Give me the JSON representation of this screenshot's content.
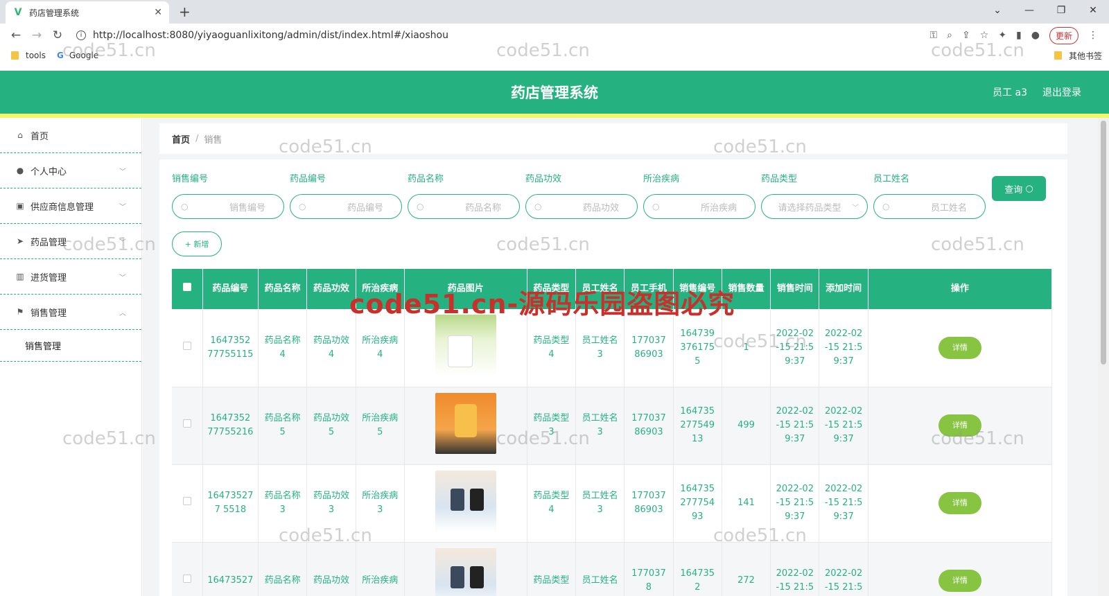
{
  "browser": {
    "tab_title": "药店管理系统",
    "url": "http://localhost:8080/yiyaoguanlixitong/admin/dist/index.html#/xiaoshou",
    "update_label": "更新",
    "bookmarks": [
      "tools",
      "Google"
    ],
    "other_bookmarks": "其他书签"
  },
  "header": {
    "title": "药店管理系统",
    "user_label": "员工 a3",
    "logout_label": "退出登录"
  },
  "sidebar": {
    "items": [
      {
        "label": "首页",
        "icon": "home-icon"
      },
      {
        "label": "个人中心",
        "icon": "user-icon"
      },
      {
        "label": "供应商信息管理",
        "icon": "clipboard-icon"
      },
      {
        "label": "药品管理",
        "icon": "send-icon"
      },
      {
        "label": "进货管理",
        "icon": "chart-icon"
      },
      {
        "label": "销售管理",
        "icon": "flag-icon"
      }
    ],
    "submenu": "销售管理"
  },
  "breadcrumb": {
    "home": "首页",
    "sep": "/",
    "current": "销售"
  },
  "filters": [
    {
      "label": "销售编号",
      "placeholder": "销售编号"
    },
    {
      "label": "药品编号",
      "placeholder": "药品编号"
    },
    {
      "label": "药品名称",
      "placeholder": "药品名称"
    },
    {
      "label": "药品功效",
      "placeholder": "药品功效"
    },
    {
      "label": "所治疾病",
      "placeholder": "所治疾病"
    },
    {
      "label": "药品类型",
      "placeholder": "请选择药品类型"
    },
    {
      "label": "员工姓名",
      "placeholder": "员工姓名"
    }
  ],
  "query_label": "查询",
  "add_label": "+ 新增",
  "table": {
    "headers": [
      "药品编号",
      "药品名称",
      "药品功效",
      "所治疾病",
      "药品图片",
      "药品类型",
      "员工姓名",
      "员工手机",
      "销售编号",
      "销售数量",
      "销售时间",
      "添加时间",
      "操作"
    ],
    "detail_label": "详情",
    "rows": [
      [
        "1647352 77755115",
        "药品名称4",
        "药品功效4",
        "所治疾病4",
        "img-a",
        "药品类型4",
        "员工姓名3",
        "17703786903",
        "1647393761755",
        "1",
        "2022-02-15 21:59:37",
        "2022-02-15 21:59:37"
      ],
      [
        "1647352 77755216",
        "药品名称5",
        "药品功效5",
        "所治疾病5",
        "img-b",
        "药品类型3",
        "员工姓名3",
        "17703786903",
        "16473527754913",
        "499",
        "2022-02-15 21:59:37",
        "2022-02-15 21:59:37"
      ],
      [
        "164735277 5518",
        "药品名称3",
        "药品功效3",
        "所治疾病3",
        "img-c",
        "药品类型4",
        "员工姓名3",
        "17703786903",
        "16473527775493",
        "141",
        "2022-02-15 21:59:37",
        "2022-02-15 21:59:37"
      ],
      [
        "16473527",
        "药品名称",
        "药品功效",
        "所治疾病",
        "img-c",
        "药品类型",
        "员工姓名",
        "1770378",
        "1647352",
        "272",
        "2022-02-15 21:5",
        "2022-02-15 21:5"
      ]
    ]
  },
  "watermark": "code51.cn",
  "watermark_big": "code51.cn-源码乐园盗图必究"
}
